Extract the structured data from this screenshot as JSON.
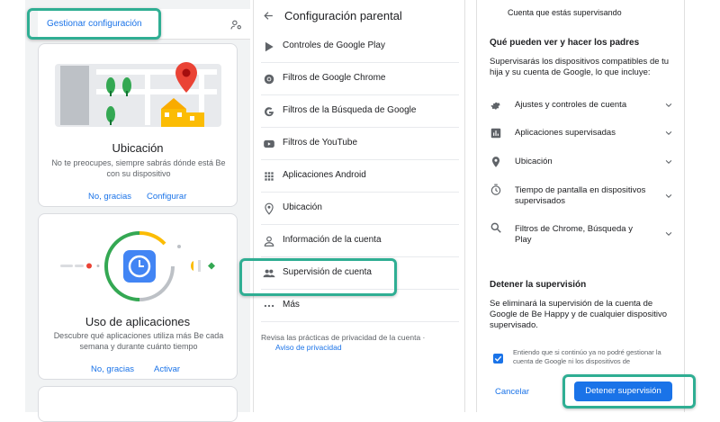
{
  "left_panel": {
    "manage_label": "Gestionar configuración",
    "location_card": {
      "title": "Ubicación",
      "description": "No te preocupes, siempre sabrás dónde está Be con su dispositivo",
      "dismiss": "No, gracias",
      "action": "Configurar"
    },
    "apps_card": {
      "title": "Uso de aplicaciones",
      "description": "Descubre qué aplicaciones utiliza más Be cada semana y durante cuánto tiempo",
      "dismiss": "No, gracias",
      "action": "Activar"
    }
  },
  "middle_panel": {
    "title": "Configuración parental",
    "items": [
      {
        "label": "Controles de Google Play",
        "icon": "play-store-icon"
      },
      {
        "label": "Filtros de Google Chrome",
        "icon": "chrome-icon"
      },
      {
        "label": "Filtros de la Búsqueda de Google",
        "icon": "google-icon"
      },
      {
        "label": "Filtros de YouTube",
        "icon": "youtube-icon"
      },
      {
        "label": "Aplicaciones Android",
        "icon": "apps-grid-icon"
      },
      {
        "label": "Ubicación",
        "icon": "location-pin-icon"
      },
      {
        "label": "Información de la cuenta",
        "icon": "person-icon"
      },
      {
        "label": "Supervisión de cuenta",
        "icon": "people-icon"
      },
      {
        "label": "Más",
        "icon": "more-horizontal-icon"
      }
    ],
    "privacy_text": "Revisa las prácticas de privacidad de la cuenta ·",
    "privacy_link": "Aviso de privacidad"
  },
  "right_panel": {
    "top_text": "Cuenta que estás supervisando",
    "section_title": "Qué pueden ver y hacer los padres",
    "section_desc": "Supervisarás los dispositivos compatibles de tu hija y su cuenta de Google, lo que incluye:",
    "items": [
      {
        "label": "Ajustes y controles de cuenta",
        "icon": "gear-icon"
      },
      {
        "label": "Aplicaciones supervisadas",
        "icon": "bar-chart-icon"
      },
      {
        "label": "Ubicación",
        "icon": "location-pin-icon"
      },
      {
        "label": "Tiempo de pantalla en dispositivos supervisados",
        "icon": "timer-icon"
      },
      {
        "label": "Filtros de Chrome, Búsqueda y Play",
        "icon": "search-icon"
      }
    ],
    "stop_title": "Detener la supervisión",
    "stop_desc": "Se eliminará la supervisión de la cuenta de Google de Be Happy y de cualquier dispositivo supervisado.",
    "checkbox_text": "Entiendo que si continúo ya no podré gestionar la cuenta de Google ni los dispositivos de",
    "cancel_label": "Cancelar",
    "stop_button": "Detener supervisión"
  },
  "colors": {
    "accent": "#1a73e8",
    "highlight": "#2fae93"
  }
}
